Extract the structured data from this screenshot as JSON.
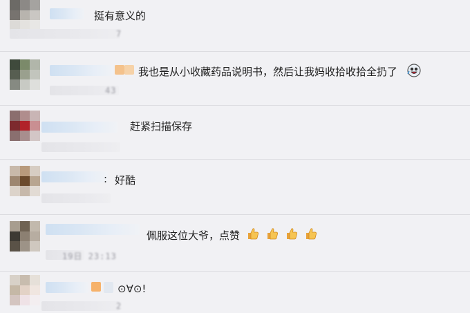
{
  "comments": [
    {
      "text": "挺有意义的",
      "meta": "7"
    },
    {
      "text": "我也是从小收藏药品说明书，然后让我妈收拾收拾全扔了",
      "meta": "43"
    },
    {
      "text": "赶紧扫描保存",
      "meta": ""
    },
    {
      "text": "好酷",
      "prefix": ":",
      "meta": ""
    },
    {
      "text": "佩服这位大爷，点赞",
      "meta": "19日 23:13"
    },
    {
      "text": "⊙∀⊙!",
      "meta": "2"
    }
  ],
  "icons": {
    "laugh_emoji": "laughing-crying-face-icon",
    "thumbs_up": "thumbs-up-icon"
  },
  "colors": {
    "background": "#f1f1f4",
    "divider": "#dcdce0",
    "name_blur": "#cfe0f2",
    "text": "#222222"
  }
}
